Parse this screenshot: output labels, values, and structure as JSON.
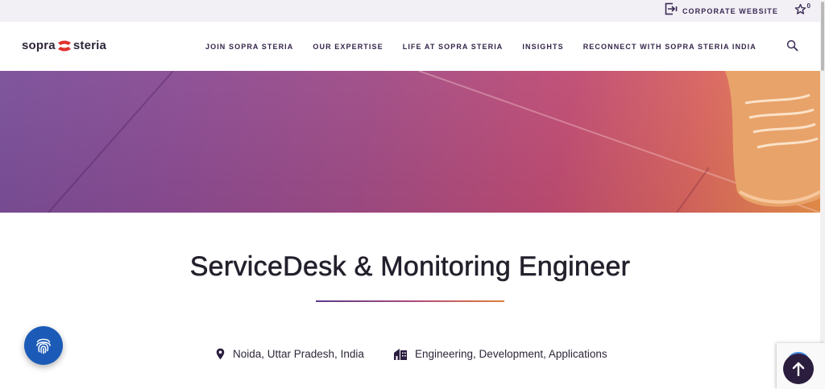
{
  "topbar": {
    "corporate_label": "CORPORATE WEBSITE",
    "favorites_count": "0"
  },
  "logo": {
    "word1": "sopra",
    "word2": "steria"
  },
  "nav": {
    "items": [
      {
        "label": "JOIN SOPRA STERIA"
      },
      {
        "label": "OUR EXPERTISE"
      },
      {
        "label": "LIFE AT SOPRA STERIA"
      },
      {
        "label": "INSIGHTS"
      },
      {
        "label": "RECONNECT WITH SOPRA STERIA INDIA"
      }
    ]
  },
  "job": {
    "title": "ServiceDesk & Monitoring Engineer",
    "location": "Noida, Uttar Pradesh, India",
    "category": "Engineering, Development, Applications"
  },
  "icons": {
    "corporate": "exit-arrow-icon",
    "favorites": "star-icon",
    "search": "search-icon",
    "location": "map-pin-icon",
    "category": "building-icon",
    "fingerprint": "fingerprint-icon",
    "back_to_top": "arrow-up-icon"
  },
  "colors": {
    "brand_dark": "#2a1d3e",
    "brand_red": "#e0312e",
    "accent_blue": "#1b5bb7",
    "topbar_bg": "#f2eff5"
  }
}
